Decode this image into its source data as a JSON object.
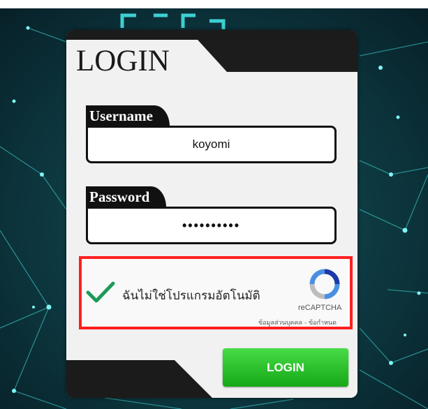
{
  "form": {
    "title": "LOGIN",
    "username_label": "Username",
    "username_value": "koyomi",
    "password_label": "Password",
    "password_value": "••••••••••"
  },
  "captcha": {
    "text": "ฉันไม่ใช่โปรแกรมอัตโนมัติ",
    "brand": "reCAPTCHA",
    "links": "ข้อมูลส่วนบุคคล - ข้อกำหนด"
  },
  "submit": {
    "label": "LOGIN"
  },
  "colors": {
    "accent_green": "#22bb22",
    "captcha_highlight": "#ff1f1f",
    "dark": "#111111",
    "background": "#0a2a33"
  },
  "icons": {
    "checkmark": "checkmark-icon",
    "recaptcha": "recaptcha-logo-icon"
  }
}
